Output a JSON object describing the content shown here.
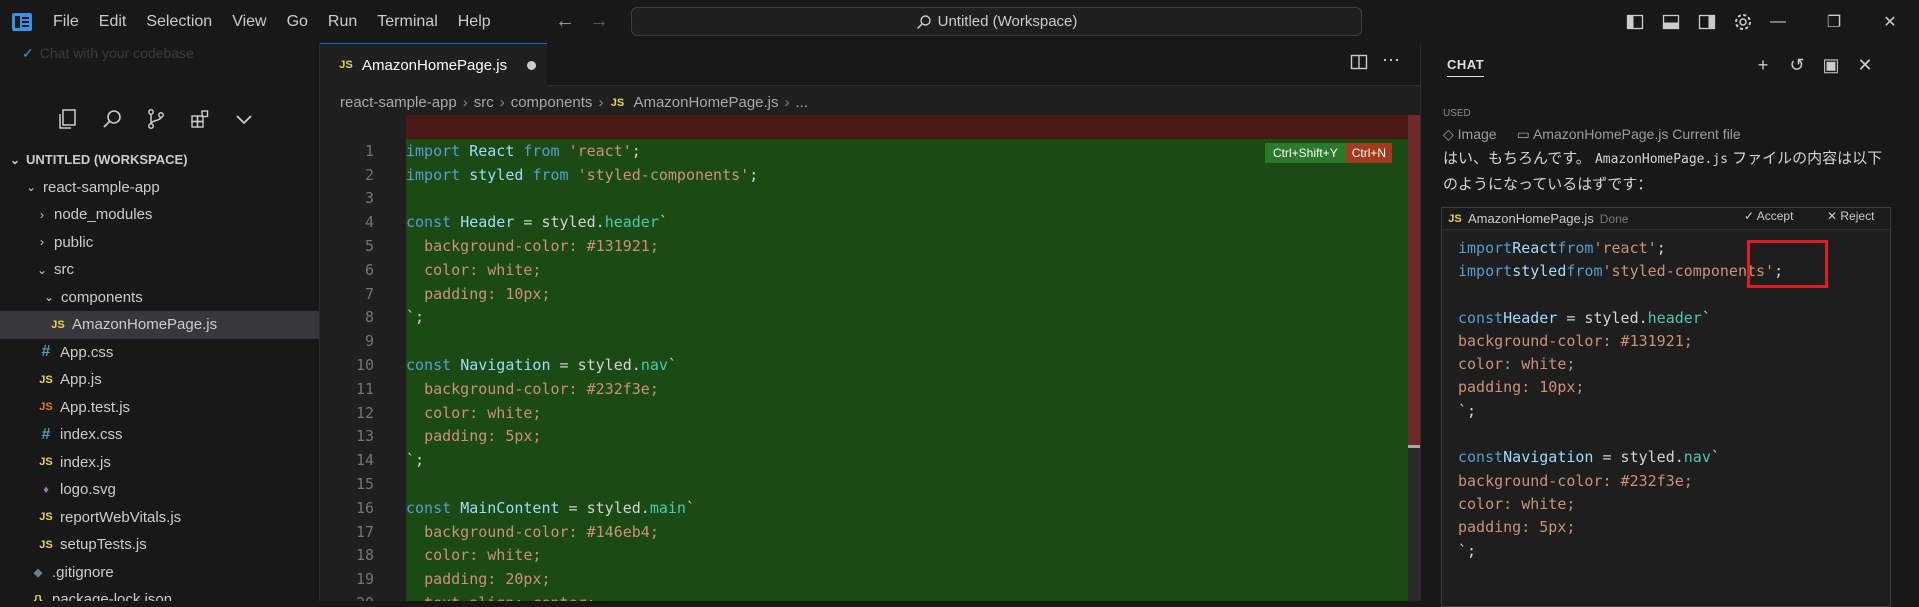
{
  "titlebar": {
    "menu": [
      "File",
      "Edit",
      "Selection",
      "View",
      "Go",
      "Run",
      "Terminal",
      "Help"
    ],
    "command_center": "Untitled (Workspace)"
  },
  "sidebar": {
    "chat_hint": "Chat with your codebase",
    "workspace_title": "UNTITLED (WORKSPACE)",
    "tree": [
      {
        "label": "react-sample-app",
        "type": "folder-open",
        "indent": 1
      },
      {
        "label": "node_modules",
        "type": "folder",
        "indent": 2
      },
      {
        "label": "public",
        "type": "folder",
        "indent": 2
      },
      {
        "label": "src",
        "type": "folder-open",
        "indent": 2
      },
      {
        "label": "components",
        "type": "folder-open",
        "indent": 3
      },
      {
        "label": "AmazonHomePage.js",
        "type": "js",
        "indent": 4,
        "selected": true
      },
      {
        "label": "App.css",
        "type": "css",
        "indent": 3
      },
      {
        "label": "App.js",
        "type": "js",
        "indent": 3
      },
      {
        "label": "App.test.js",
        "type": "jstest",
        "indent": 3
      },
      {
        "label": "index.css",
        "type": "css",
        "indent": 3
      },
      {
        "label": "index.js",
        "type": "js",
        "indent": 3
      },
      {
        "label": "logo.svg",
        "type": "svg",
        "indent": 3
      },
      {
        "label": "reportWebVitals.js",
        "type": "js",
        "indent": 3
      },
      {
        "label": "setupTests.js",
        "type": "js",
        "indent": 3
      },
      {
        "label": ".gitignore",
        "type": "git",
        "indent": 2
      },
      {
        "label": "package-lock.json",
        "type": "json",
        "indent": 2
      }
    ]
  },
  "editor": {
    "tab_label": "AmazonHomePage.js",
    "breadcrumb": [
      "react-sample-app",
      "src",
      "components",
      "AmazonHomePage.js",
      "..."
    ],
    "shortcut_accept": "Ctrl+Shift+Y",
    "shortcut_reject": "Ctrl+N",
    "lines": [
      {
        "n": "1",
        "t": "import React from 'react';"
      },
      {
        "n": "2",
        "t": "import styled from 'styled-components';"
      },
      {
        "n": "3",
        "t": ""
      },
      {
        "n": "4",
        "t": "const Header = styled.header`"
      },
      {
        "n": "5",
        "t": "  background-color: #131921;"
      },
      {
        "n": "6",
        "t": "  color: white;"
      },
      {
        "n": "7",
        "t": "  padding: 10px;"
      },
      {
        "n": "8",
        "t": "`;"
      },
      {
        "n": "9",
        "t": ""
      },
      {
        "n": "10",
        "t": "const Navigation = styled.nav`"
      },
      {
        "n": "11",
        "t": "  background-color: #232f3e;"
      },
      {
        "n": "12",
        "t": "  color: white;"
      },
      {
        "n": "13",
        "t": "  padding: 5px;"
      },
      {
        "n": "14",
        "t": "`;"
      },
      {
        "n": "15",
        "t": ""
      },
      {
        "n": "16",
        "t": "const MainContent = styled.main`"
      },
      {
        "n": "17",
        "t": "  background-color: #146eb4;"
      },
      {
        "n": "18",
        "t": "  color: white;"
      },
      {
        "n": "19",
        "t": "  padding: 20px;"
      },
      {
        "n": "20",
        "t": "  text-align: center;"
      }
    ]
  },
  "chat": {
    "title": "CHAT",
    "used_label": "USED",
    "used_image": "Image",
    "used_file": "AmazonHomePage.js",
    "used_file_note": "Current file",
    "message_pre": "はい、もちろんです。",
    "message_code": "AmazonHomePage.js",
    "message_post": " ファイルの内容は以下のようになっているはずです：",
    "codeblock": {
      "filename": "AmazonHomePage.js",
      "status": "Done",
      "accept": "Accept",
      "reject": "Reject",
      "lines": [
        "import React from 'react';",
        "import styled from 'styled-components';",
        "",
        "const Header = styled.header`",
        "  background-color: #131921;",
        "  color: white;",
        "  padding: 10px;",
        "`;",
        "",
        "const Navigation = styled.nav`",
        "  background-color: #232f3e;",
        "  color: white;",
        "  padding: 5px;",
        "`;"
      ]
    }
  },
  "colors": {
    "accent": "#0078d4",
    "diff_added": "#1b4a14",
    "diff_removed": "#4b1818",
    "highlight_box": "#e01b24"
  }
}
